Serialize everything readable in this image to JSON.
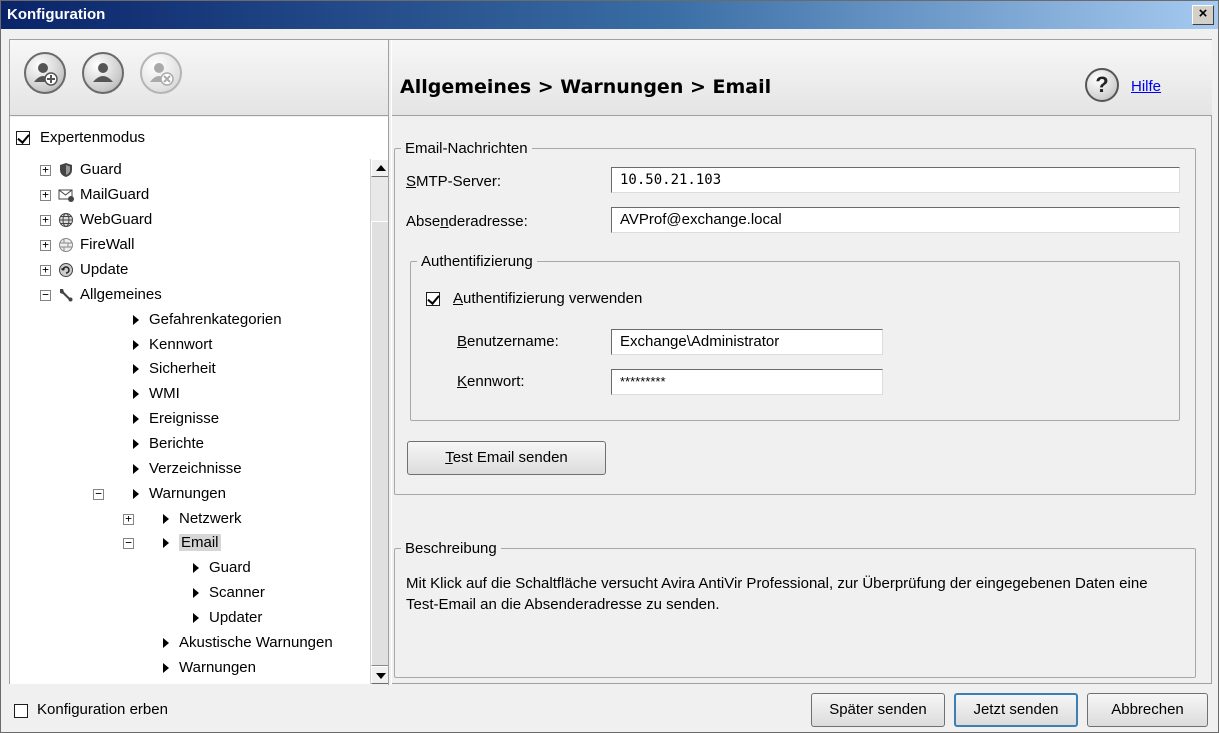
{
  "window": {
    "title": "Konfiguration",
    "close_label": "×"
  },
  "toolbar": {
    "buttons": [
      {
        "icon": "add-user-icon",
        "enabled": true
      },
      {
        "icon": "user-icon",
        "enabled": true
      },
      {
        "icon": "remove-user-icon",
        "enabled": false
      }
    ]
  },
  "tree": {
    "expert_mode_label": "Expertenmodus",
    "expert_mode_checked": true,
    "items": [
      {
        "label": "Guard",
        "icon": "shield-icon",
        "expander": "+"
      },
      {
        "label": "MailGuard",
        "icon": "mail-icon",
        "expander": "+"
      },
      {
        "label": "WebGuard",
        "icon": "globe-icon",
        "expander": "+"
      },
      {
        "label": "FireWall",
        "icon": "firewall-icon",
        "expander": "+"
      },
      {
        "label": "Update",
        "icon": "update-icon",
        "expander": "+"
      },
      {
        "label": "Allgemeines",
        "icon": "wrench-icon",
        "expander": "−"
      },
      {
        "label": "Gefahrenkategorien"
      },
      {
        "label": "Kennwort"
      },
      {
        "label": "Sicherheit"
      },
      {
        "label": "WMI"
      },
      {
        "label": "Ereignisse"
      },
      {
        "label": "Berichte"
      },
      {
        "label": "Verzeichnisse"
      },
      {
        "label": "Warnungen",
        "expander": "−"
      },
      {
        "label": "Netzwerk",
        "expander": "+"
      },
      {
        "label": "Email",
        "expander": "−"
      },
      {
        "label": "Guard"
      },
      {
        "label": "Scanner"
      },
      {
        "label": "Updater"
      },
      {
        "label": "Akustische Warnungen"
      },
      {
        "label": "Warnungen"
      }
    ]
  },
  "header": {
    "breadcrumb": "Allgemeines > Warnungen > Email",
    "help_label": "Hilfe",
    "help_glyph": "?"
  },
  "email_group": {
    "legend": "Email-Nachrichten",
    "smtp_label_pre": "",
    "smtp_label_u": "S",
    "smtp_label_post": "MTP-Server:",
    "smtp_value": "10.50.21.103",
    "sender_label_pre": "Abse",
    "sender_label_u": "n",
    "sender_label_post": "deradresse:",
    "sender_value": "AVProf@exchange.local",
    "auth_group": {
      "legend": "Authentifizierung",
      "use_auth_pre": "",
      "use_auth_u": "A",
      "use_auth_post": "uthentifizierung verwenden",
      "use_auth_checked": true,
      "username_label_u": "B",
      "username_label_post": "enutzername:",
      "username_value": "Exchange\\Administrator",
      "password_label_u": "K",
      "password_label_post": "ennwort:",
      "password_value": "*********"
    },
    "test_button_u": "T",
    "test_button_post": "est Email senden"
  },
  "description": {
    "legend": "Beschreibung",
    "text": "Mit Klick auf die Schaltfläche versucht Avira AntiVir Professional, zur Überprüfung der eingegebenen Daten eine Test-Email an die Absenderadresse zu senden."
  },
  "footer": {
    "inherit_label": "Konfiguration erben",
    "inherit_checked": false,
    "send_later": "Später senden",
    "send_now": "Jetzt senden",
    "cancel": "Abbrechen"
  }
}
